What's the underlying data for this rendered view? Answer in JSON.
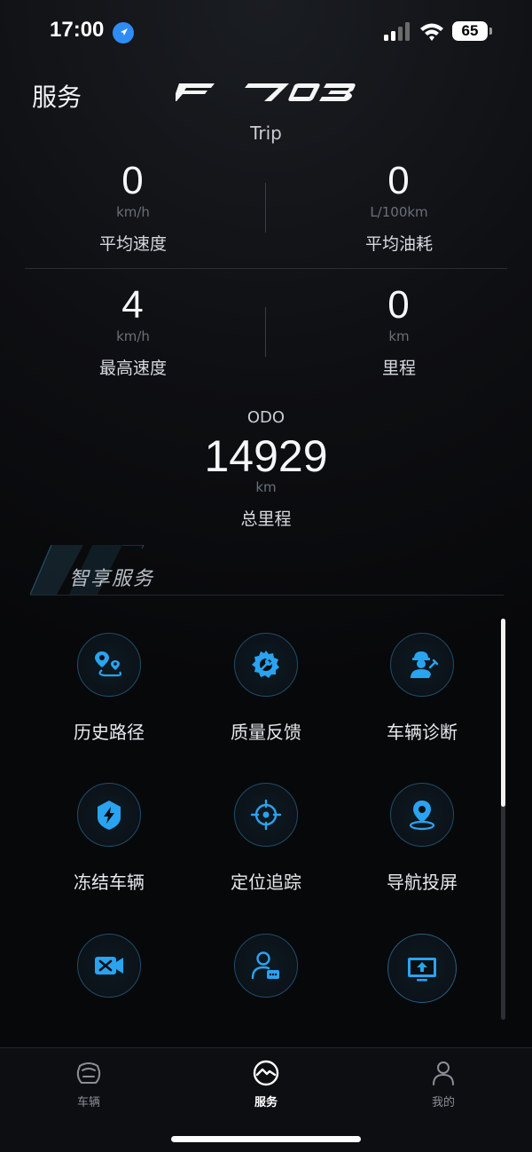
{
  "status": {
    "time": "17:00",
    "battery": "65"
  },
  "header": {
    "title": "服务",
    "brand": "F703"
  },
  "trip": {
    "label": "Trip",
    "avg_speed": {
      "value": "0",
      "unit": "km/h",
      "label": "平均速度"
    },
    "avg_fuel": {
      "value": "0",
      "unit": "L/100km",
      "label": "平均油耗"
    },
    "max_speed": {
      "value": "4",
      "unit": "km/h",
      "label": "最高速度"
    },
    "mileage": {
      "value": "0",
      "unit": "km",
      "label": "里程"
    }
  },
  "odo": {
    "label": "ODO",
    "value": "14929",
    "unit": "km",
    "total_label": "总里程"
  },
  "section": {
    "title": "智享服务"
  },
  "services": [
    {
      "label": "历史路径",
      "icon": "route-icon"
    },
    {
      "label": "质量反馈",
      "icon": "wrench-gear-icon"
    },
    {
      "label": "车辆诊断",
      "icon": "mechanic-icon"
    },
    {
      "label": "冻结车辆",
      "icon": "lightning-shield-icon"
    },
    {
      "label": "定位追踪",
      "icon": "target-icon"
    },
    {
      "label": "导航投屏",
      "icon": "map-pin-icon"
    },
    {
      "label": "",
      "icon": "video-tools-icon"
    },
    {
      "label": "",
      "icon": "user-chat-icon"
    },
    {
      "label": "",
      "icon": "screen-upload-icon"
    }
  ],
  "tabs": [
    {
      "label": "车辆",
      "icon": "vehicle-icon",
      "active": false
    },
    {
      "label": "服务",
      "icon": "service-icon",
      "active": true
    },
    {
      "label": "我的",
      "icon": "user-icon",
      "active": false
    }
  ],
  "colors": {
    "accent": "#2aa3f0",
    "background": "#0b0c0f"
  }
}
